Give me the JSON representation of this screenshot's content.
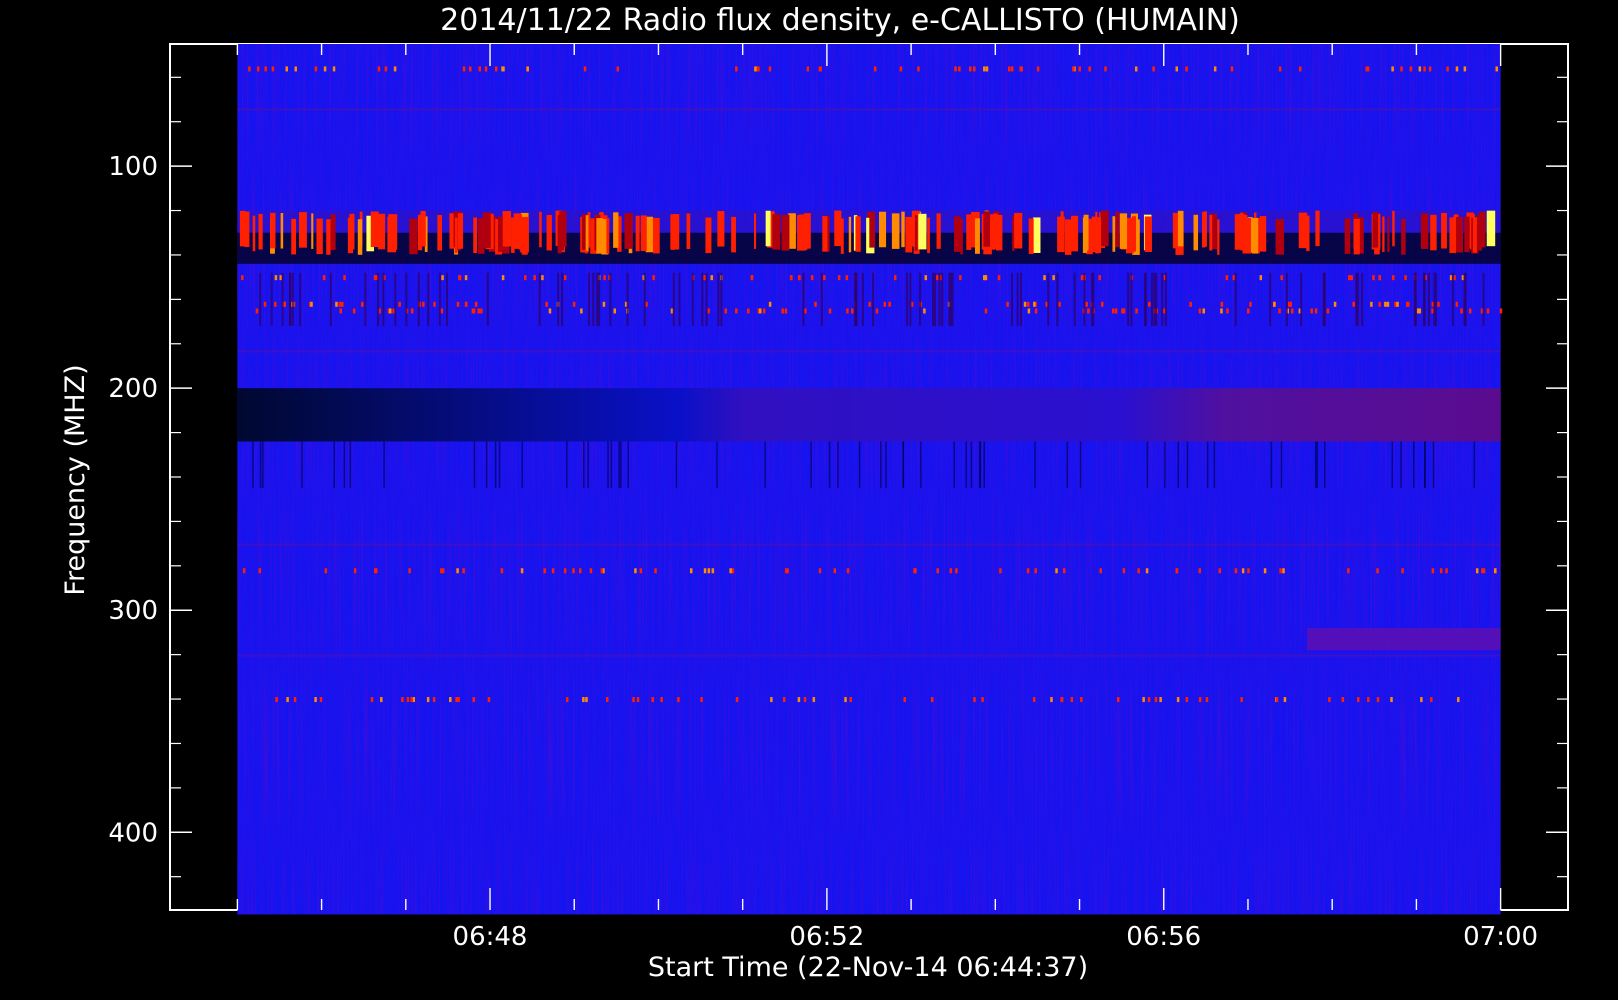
{
  "chart_data": {
    "type": "heatmap",
    "title": "2014/11/22  Radio flux density, e-CALLISTO (HUMAIN)",
    "xlabel": "Start Time (22-Nov-14 06:44:37)",
    "ylabel": "Frequency (MHZ)",
    "xlim_minutes": [
      6.2,
      22.8
    ],
    "ylim": [
      45,
      435
    ],
    "y_axis_inverted": true,
    "x_ticks": [
      {
        "label": "06:48",
        "minute": 10
      },
      {
        "label": "06:52",
        "minute": 14
      },
      {
        "label": "06:56",
        "minute": 18
      },
      {
        "label": "07:00",
        "minute": 22
      }
    ],
    "x_minor_tick_minutes": [
      7,
      8,
      9,
      10,
      11,
      12,
      13,
      14,
      15,
      16,
      17,
      18,
      19,
      20,
      21,
      22
    ],
    "y_ticks": [
      100,
      200,
      300,
      400
    ],
    "y_minor_step": 20,
    "data_time_range_minutes": [
      7,
      22
    ],
    "data_freq_range": [
      45,
      437
    ],
    "background_color": "#1414f0",
    "colors": {
      "hot": "#ff2000",
      "warm": "#ff8c00",
      "hottest": "#ffff60",
      "dark": "#000010",
      "purple": "#5a10b4",
      "mid_red": "#b00010"
    },
    "bands": [
      {
        "f0": 120,
        "f1": 130,
        "kind": "burst-band"
      },
      {
        "f0": 130,
        "f1": 140,
        "kind": "dark-band"
      },
      {
        "f0": 140,
        "f1": 144,
        "kind": "dark-band"
      },
      {
        "f0": 200,
        "f1": 224,
        "kind": "dark-to-purple"
      },
      {
        "f0": 308,
        "f1": 318,
        "t0": 19.7,
        "t1": 22,
        "kind": "purple-strip"
      },
      {
        "f0": 150,
        "f1": 170,
        "kind": "spike-band"
      }
    ]
  }
}
